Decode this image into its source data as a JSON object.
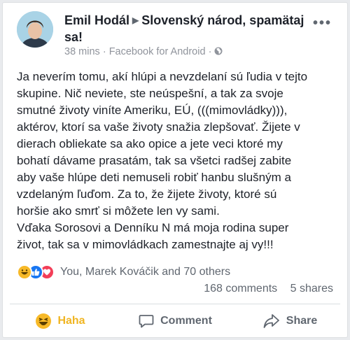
{
  "post": {
    "author": "Emil Hodál",
    "group": "Slovenský národ, spamätaj sa!",
    "time": "38 mins",
    "separator": "·",
    "source": "Facebook for Android",
    "text_lines": [
      "Ja neverím tomu, akí hlúpi a nevzdelaní sú ľudia v tejto",
      "skupine. Nič neviete, ste neúspešní, a tak za svoje",
      "smutné životy viníte Ameriku, EÚ, (((mimovládky))),",
      "aktérov, ktorí sa vaše životy snažia zlepšovať. Žijete v",
      "dierach obliekate sa ako opice a jete veci ktoré my",
      "bohatí dávame prasatám, tak sa všetci radšej zabite",
      "aby vaše hlúpe deti nemuseli robiť hanbu slušným a",
      "vzdelaným ľuďom. Za to, že žijete životy, ktoré sú",
      "horšie ako smrť si môžete len vy sami.",
      "Vďaka Sorosovi a Denníku N má moja rodina super",
      "život, tak sa v mimovládkach zamestnajte aj vy!!!"
    ]
  },
  "reactions": {
    "names": "You, Marek Kováčik and 70 others",
    "comments": "168 comments",
    "shares": "5 shares",
    "icons": [
      "haha-icon",
      "like-icon",
      "love-icon"
    ]
  },
  "actions": {
    "haha": "Haha",
    "comment": "Comment",
    "share": "Share"
  },
  "colors": {
    "haha": "#f0b522",
    "like": "#1877f2",
    "love": "#f33e58"
  }
}
